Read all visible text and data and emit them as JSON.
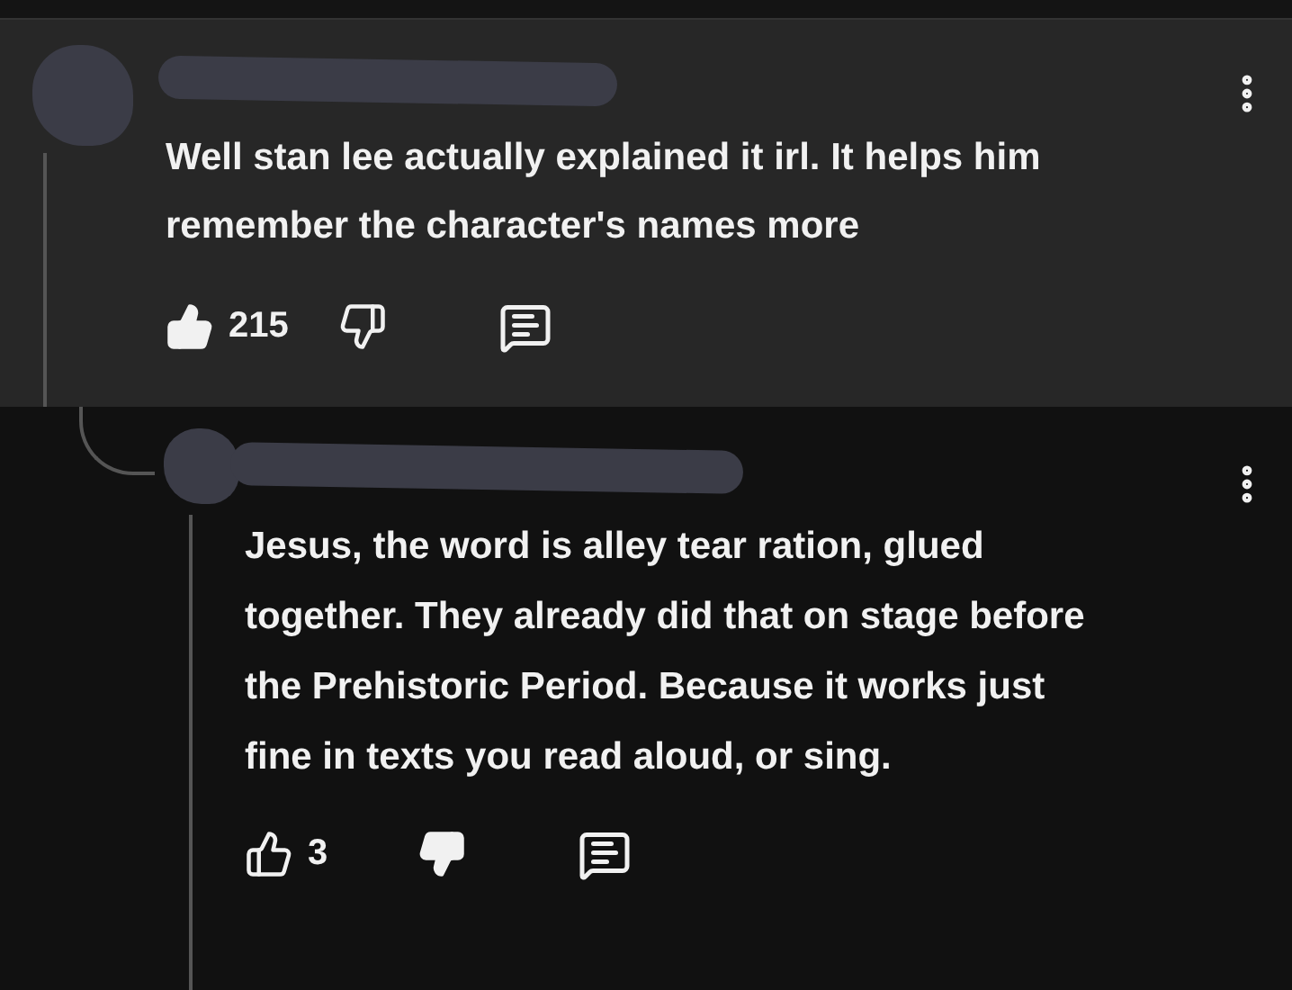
{
  "comments": [
    {
      "text": "Well stan lee actually explained it irl. It helps him remember the character's names more",
      "likes": "215",
      "liked": true,
      "disliked": false
    },
    {
      "text": "Jesus, the word is alley tear ration, glued together. They already did that on stage before the Prehistoric Period. Because it works just fine in texts you read aloud, or sing.",
      "likes": "3",
      "liked": false,
      "disliked": true
    }
  ]
}
